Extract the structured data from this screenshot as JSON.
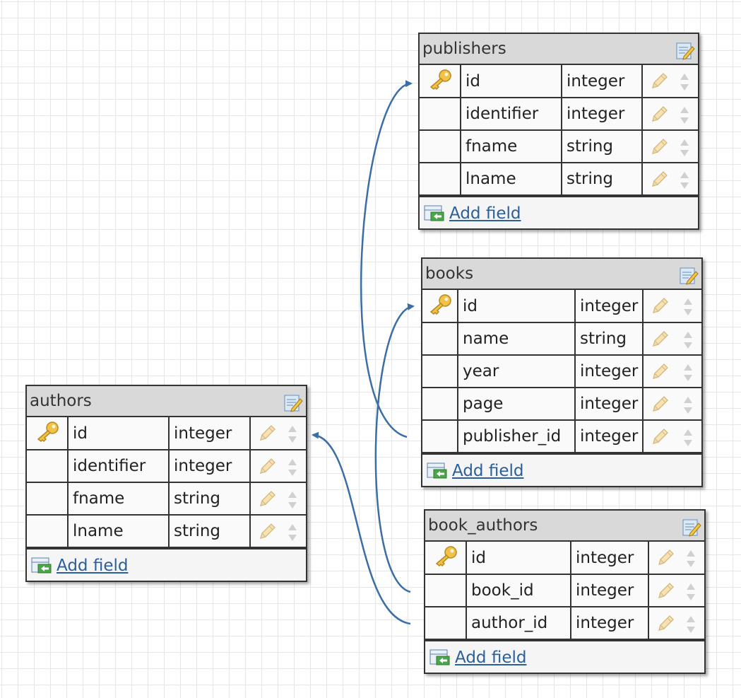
{
  "tables": [
    {
      "name": "publishers",
      "fields": [
        {
          "name": "id",
          "type": "integer",
          "key": true
        },
        {
          "name": "identifier",
          "type": "integer",
          "key": false
        },
        {
          "name": "fname",
          "type": "string",
          "key": false
        },
        {
          "name": "lname",
          "type": "string",
          "key": false
        }
      ],
      "add_label": "Add field"
    },
    {
      "name": "books",
      "fields": [
        {
          "name": "id",
          "type": "integer",
          "key": true
        },
        {
          "name": "name",
          "type": "string",
          "key": false
        },
        {
          "name": "year",
          "type": "integer",
          "key": false
        },
        {
          "name": "page",
          "type": "integer",
          "key": false
        },
        {
          "name": "publisher_id",
          "type": "integer",
          "key": false
        }
      ],
      "add_label": "Add field"
    },
    {
      "name": "authors",
      "fields": [
        {
          "name": "id",
          "type": "integer",
          "key": true
        },
        {
          "name": "identifier",
          "type": "integer",
          "key": false
        },
        {
          "name": "fname",
          "type": "string",
          "key": false
        },
        {
          "name": "lname",
          "type": "string",
          "key": false
        }
      ],
      "add_label": "Add field"
    },
    {
      "name": "book_authors",
      "fields": [
        {
          "name": "id",
          "type": "integer",
          "key": true
        },
        {
          "name": "book_id",
          "type": "integer",
          "key": false
        },
        {
          "name": "author_id",
          "type": "integer",
          "key": false
        }
      ],
      "add_label": "Add field"
    }
  ],
  "relations": [
    {
      "from": "books.publisher_id",
      "to": "publishers.id"
    },
    {
      "from": "book_authors.book_id",
      "to": "books.id"
    },
    {
      "from": "book_authors.author_id",
      "to": "authors.id"
    }
  ],
  "colors": {
    "link": "#3b6ea5",
    "header": "#d9d9d9",
    "grid": "#e6e6e6"
  },
  "icons": {
    "key": "key-icon",
    "edit": "edit-table-icon",
    "pencil": "pencil-icon",
    "sort": "sort-arrows-icon",
    "add": "add-field-icon"
  }
}
